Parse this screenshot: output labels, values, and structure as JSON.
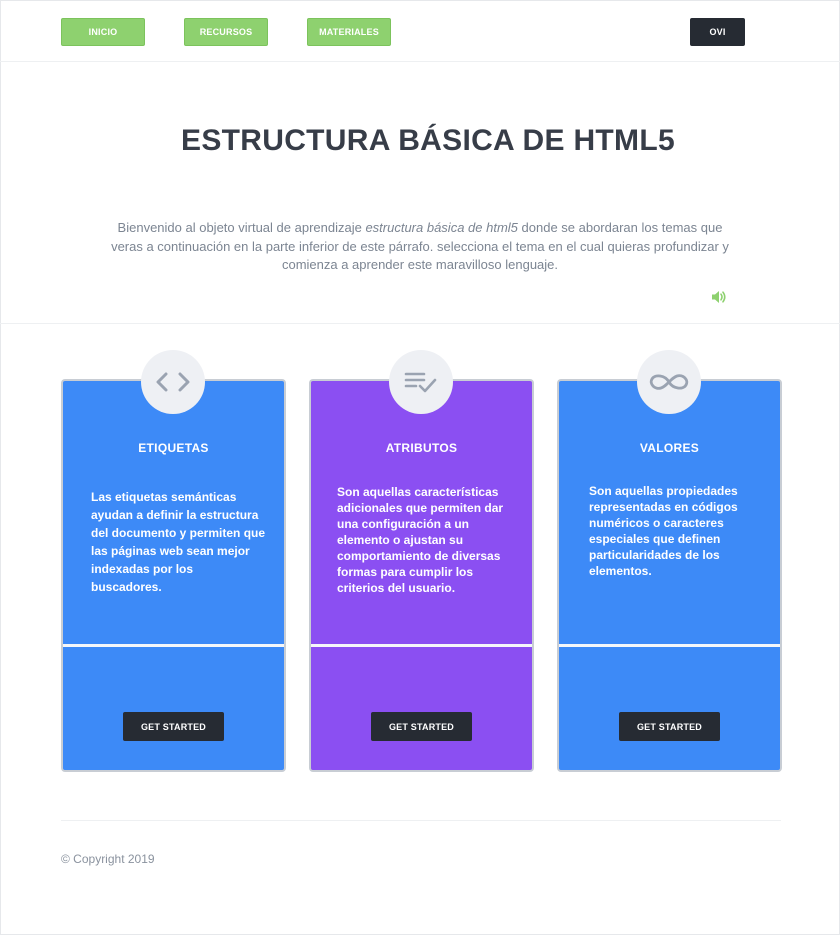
{
  "nav": {
    "items": [
      {
        "label": "INICIO"
      },
      {
        "label": "RECURSOS"
      },
      {
        "label": "MATERIALES"
      }
    ],
    "account_label": "OVI"
  },
  "hero": {
    "title": "ESTRUCTURA BÁSICA DE HTML5",
    "intro_before": "Bienvenido al objeto virtual de aprendizaje ",
    "intro_emphasis": "estructura básica de html5",
    "intro_after": " donde se abordaran los temas que veras a continuación en la parte inferior de este párrafo. selecciona el tema en el cual quieras profundizar y comienza a aprender este maravilloso lenguaje.",
    "audio_icon": "speaker-icon",
    "accent_color": "#8ed16f"
  },
  "cards": [
    {
      "icon": "code-icon",
      "title": "ETIQUETAS",
      "description": "Las etiquetas semánticas ayudan a definir la estructura del documento y permiten que las páginas web sean mejor indexadas por los buscadores.",
      "button_label": "GET STARTED",
      "color": "#3d8af7"
    },
    {
      "icon": "checklist-icon",
      "title": "ATRIBUTOS",
      "description": "Son aquellas características adicionales que permiten dar una configuración a un elemento o ajustan su comportamiento de diversas formas para cumplir los criterios del usuario.",
      "button_label": "GET STARTED",
      "color": "#8b4ff2"
    },
    {
      "icon": "infinity-icon",
      "title": "VALORES",
      "description": "Son aquellas propiedades representadas en códigos numéricos o caracteres especiales que definen particularidades de los elementos.",
      "button_label": "GET STARTED",
      "color": "#3d8af7"
    }
  ],
  "footer": {
    "copyright": "© Copyright 2019"
  }
}
